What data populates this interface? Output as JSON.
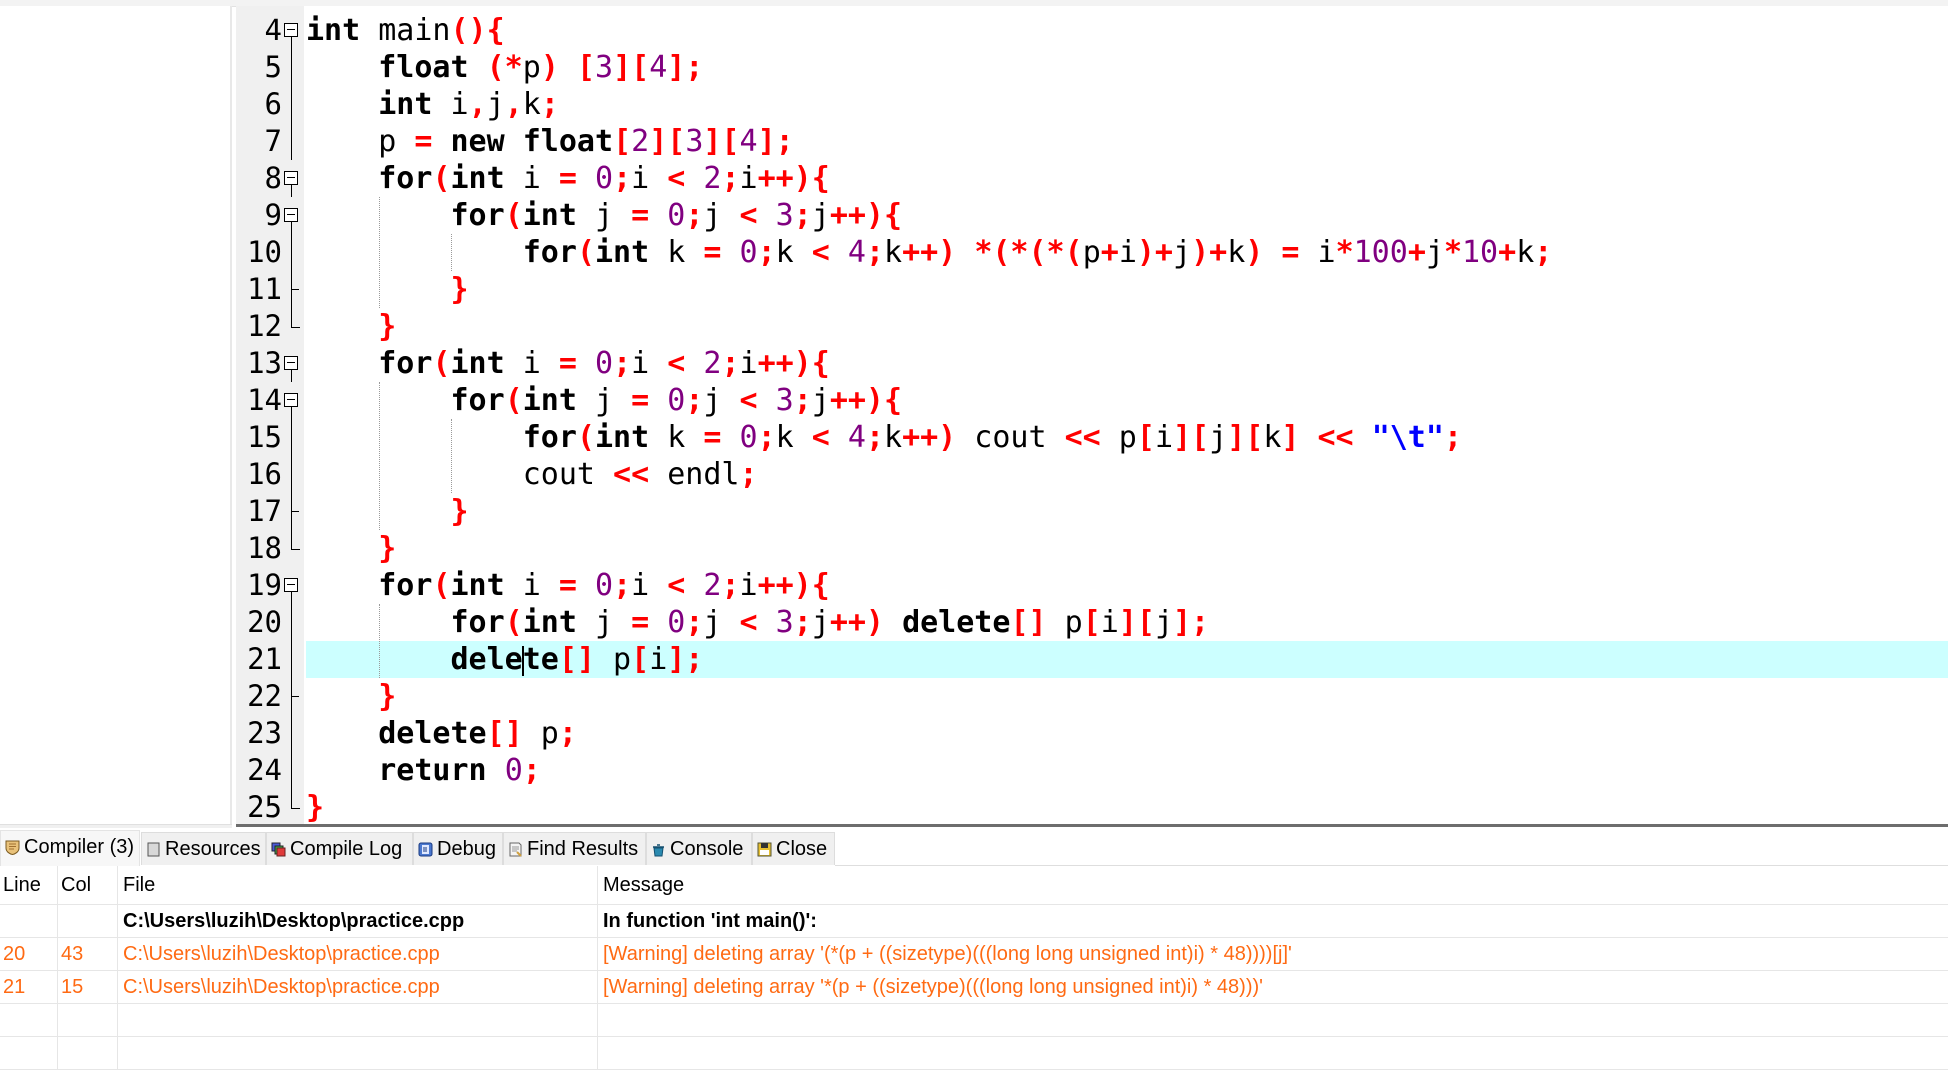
{
  "editor": {
    "current_line": 21,
    "lines": [
      {
        "n": "4",
        "fold": "start",
        "tokens": [
          [
            "kw",
            "int"
          ],
          [
            "id",
            " main"
          ],
          [
            "op",
            "(){"
          ]
        ]
      },
      {
        "n": "5",
        "fold": "mid",
        "tokens": [
          [
            "id",
            "    "
          ],
          [
            "kw",
            "float"
          ],
          [
            "id",
            " "
          ],
          [
            "op",
            "(*"
          ],
          [
            "id",
            "p"
          ],
          [
            "op",
            ")"
          ],
          [
            "id",
            " "
          ],
          [
            "op",
            "["
          ],
          [
            "num",
            "3"
          ],
          [
            "op",
            "]["
          ],
          [
            "num",
            "4"
          ],
          [
            "op",
            "];"
          ]
        ]
      },
      {
        "n": "6",
        "fold": "mid",
        "tokens": [
          [
            "id",
            "    "
          ],
          [
            "kw",
            "int"
          ],
          [
            "id",
            " i"
          ],
          [
            "op",
            ","
          ],
          [
            "id",
            "j"
          ],
          [
            "op",
            ","
          ],
          [
            "id",
            "k"
          ],
          [
            "op",
            ";"
          ]
        ]
      },
      {
        "n": "7",
        "fold": "mid",
        "tokens": [
          [
            "id",
            "    p "
          ],
          [
            "op",
            "="
          ],
          [
            "id",
            " "
          ],
          [
            "kw",
            "new float"
          ],
          [
            "op",
            "["
          ],
          [
            "num",
            "2"
          ],
          [
            "op",
            "]["
          ],
          [
            "num",
            "3"
          ],
          [
            "op",
            "]["
          ],
          [
            "num",
            "4"
          ],
          [
            "op",
            "];"
          ]
        ]
      },
      {
        "n": "8",
        "fold": "start",
        "tokens": [
          [
            "id",
            "    "
          ],
          [
            "kw",
            "for"
          ],
          [
            "op",
            "("
          ],
          [
            "kw",
            "int"
          ],
          [
            "id",
            " i "
          ],
          [
            "op",
            "="
          ],
          [
            "id",
            " "
          ],
          [
            "num",
            "0"
          ],
          [
            "op",
            ";"
          ],
          [
            "id",
            "i "
          ],
          [
            "op",
            "<"
          ],
          [
            "id",
            " "
          ],
          [
            "num",
            "2"
          ],
          [
            "op",
            ";"
          ],
          [
            "id",
            "i"
          ],
          [
            "op",
            "++){"
          ]
        ]
      },
      {
        "n": "9",
        "fold": "start",
        "tokens": [
          [
            "id",
            "        "
          ],
          [
            "kw",
            "for"
          ],
          [
            "op",
            "("
          ],
          [
            "kw",
            "int"
          ],
          [
            "id",
            " j "
          ],
          [
            "op",
            "="
          ],
          [
            "id",
            " "
          ],
          [
            "num",
            "0"
          ],
          [
            "op",
            ";"
          ],
          [
            "id",
            "j "
          ],
          [
            "op",
            "<"
          ],
          [
            "id",
            " "
          ],
          [
            "num",
            "3"
          ],
          [
            "op",
            ";"
          ],
          [
            "id",
            "j"
          ],
          [
            "op",
            "++){"
          ]
        ]
      },
      {
        "n": "10",
        "fold": "mid",
        "tokens": [
          [
            "id",
            "            "
          ],
          [
            "kw",
            "for"
          ],
          [
            "op",
            "("
          ],
          [
            "kw",
            "int"
          ],
          [
            "id",
            " k "
          ],
          [
            "op",
            "="
          ],
          [
            "id",
            " "
          ],
          [
            "num",
            "0"
          ],
          [
            "op",
            ";"
          ],
          [
            "id",
            "k "
          ],
          [
            "op",
            "<"
          ],
          [
            "id",
            " "
          ],
          [
            "num",
            "4"
          ],
          [
            "op",
            ";"
          ],
          [
            "id",
            "k"
          ],
          [
            "op",
            "++)"
          ],
          [
            "id",
            " "
          ],
          [
            "op",
            "*(*(*("
          ],
          [
            "id",
            "p"
          ],
          [
            "op",
            "+"
          ],
          [
            "id",
            "i"
          ],
          [
            "op",
            ")+"
          ],
          [
            "id",
            "j"
          ],
          [
            "op",
            ")+"
          ],
          [
            "id",
            "k"
          ],
          [
            "op",
            ")"
          ],
          [
            "id",
            " "
          ],
          [
            "op",
            "="
          ],
          [
            "id",
            " i"
          ],
          [
            "op",
            "*"
          ],
          [
            "num",
            "100"
          ],
          [
            "op",
            "+"
          ],
          [
            "id",
            "j"
          ],
          [
            "op",
            "*"
          ],
          [
            "num",
            "10"
          ],
          [
            "op",
            "+"
          ],
          [
            "id",
            "k"
          ],
          [
            "op",
            ";"
          ]
        ]
      },
      {
        "n": "11",
        "fold": "end-mid",
        "tokens": [
          [
            "id",
            "        "
          ],
          [
            "op",
            "}"
          ]
        ]
      },
      {
        "n": "12",
        "fold": "end",
        "tokens": [
          [
            "id",
            "    "
          ],
          [
            "op",
            "}"
          ]
        ]
      },
      {
        "n": "13",
        "fold": "start",
        "tokens": [
          [
            "id",
            "    "
          ],
          [
            "kw",
            "for"
          ],
          [
            "op",
            "("
          ],
          [
            "kw",
            "int"
          ],
          [
            "id",
            " i "
          ],
          [
            "op",
            "="
          ],
          [
            "id",
            " "
          ],
          [
            "num",
            "0"
          ],
          [
            "op",
            ";"
          ],
          [
            "id",
            "i "
          ],
          [
            "op",
            "<"
          ],
          [
            "id",
            " "
          ],
          [
            "num",
            "2"
          ],
          [
            "op",
            ";"
          ],
          [
            "id",
            "i"
          ],
          [
            "op",
            "++){"
          ]
        ]
      },
      {
        "n": "14",
        "fold": "start",
        "tokens": [
          [
            "id",
            "        "
          ],
          [
            "kw",
            "for"
          ],
          [
            "op",
            "("
          ],
          [
            "kw",
            "int"
          ],
          [
            "id",
            " j "
          ],
          [
            "op",
            "="
          ],
          [
            "id",
            " "
          ],
          [
            "num",
            "0"
          ],
          [
            "op",
            ";"
          ],
          [
            "id",
            "j "
          ],
          [
            "op",
            "<"
          ],
          [
            "id",
            " "
          ],
          [
            "num",
            "3"
          ],
          [
            "op",
            ";"
          ],
          [
            "id",
            "j"
          ],
          [
            "op",
            "++){"
          ]
        ]
      },
      {
        "n": "15",
        "fold": "mid",
        "tokens": [
          [
            "id",
            "            "
          ],
          [
            "kw",
            "for"
          ],
          [
            "op",
            "("
          ],
          [
            "kw",
            "int"
          ],
          [
            "id",
            " k "
          ],
          [
            "op",
            "="
          ],
          [
            "id",
            " "
          ],
          [
            "num",
            "0"
          ],
          [
            "op",
            ";"
          ],
          [
            "id",
            "k "
          ],
          [
            "op",
            "<"
          ],
          [
            "id",
            " "
          ],
          [
            "num",
            "4"
          ],
          [
            "op",
            ";"
          ],
          [
            "id",
            "k"
          ],
          [
            "op",
            "++)"
          ],
          [
            "id",
            " cout "
          ],
          [
            "op",
            "<<"
          ],
          [
            "id",
            " p"
          ],
          [
            "op",
            "["
          ],
          [
            "id",
            "i"
          ],
          [
            "op",
            "]["
          ],
          [
            "id",
            "j"
          ],
          [
            "op",
            "]["
          ],
          [
            "id",
            "k"
          ],
          [
            "op",
            "]"
          ],
          [
            "id",
            " "
          ],
          [
            "op",
            "<<"
          ],
          [
            "id",
            " "
          ],
          [
            "str",
            "\"\\t\""
          ],
          [
            "op",
            ";"
          ]
        ]
      },
      {
        "n": "16",
        "fold": "mid",
        "tokens": [
          [
            "id",
            "            cout "
          ],
          [
            "op",
            "<<"
          ],
          [
            "id",
            " endl"
          ],
          [
            "op",
            ";"
          ]
        ]
      },
      {
        "n": "17",
        "fold": "end-mid",
        "tokens": [
          [
            "id",
            "        "
          ],
          [
            "op",
            "}"
          ]
        ]
      },
      {
        "n": "18",
        "fold": "end",
        "tokens": [
          [
            "id",
            "    "
          ],
          [
            "op",
            "}"
          ]
        ]
      },
      {
        "n": "19",
        "fold": "start",
        "tokens": [
          [
            "id",
            "    "
          ],
          [
            "kw",
            "for"
          ],
          [
            "op",
            "("
          ],
          [
            "kw",
            "int"
          ],
          [
            "id",
            " i "
          ],
          [
            "op",
            "="
          ],
          [
            "id",
            " "
          ],
          [
            "num",
            "0"
          ],
          [
            "op",
            ";"
          ],
          [
            "id",
            "i "
          ],
          [
            "op",
            "<"
          ],
          [
            "id",
            " "
          ],
          [
            "num",
            "2"
          ],
          [
            "op",
            ";"
          ],
          [
            "id",
            "i"
          ],
          [
            "op",
            "++){"
          ]
        ]
      },
      {
        "n": "20",
        "fold": "mid",
        "tokens": [
          [
            "id",
            "        "
          ],
          [
            "kw",
            "for"
          ],
          [
            "op",
            "("
          ],
          [
            "kw",
            "int"
          ],
          [
            "id",
            " j "
          ],
          [
            "op",
            "="
          ],
          [
            "id",
            " "
          ],
          [
            "num",
            "0"
          ],
          [
            "op",
            ";"
          ],
          [
            "id",
            "j "
          ],
          [
            "op",
            "<"
          ],
          [
            "id",
            " "
          ],
          [
            "num",
            "3"
          ],
          [
            "op",
            ";"
          ],
          [
            "id",
            "j"
          ],
          [
            "op",
            "++)"
          ],
          [
            "id",
            " "
          ],
          [
            "kw",
            "delete"
          ],
          [
            "op",
            "[]"
          ],
          [
            "id",
            " p"
          ],
          [
            "op",
            "["
          ],
          [
            "id",
            "i"
          ],
          [
            "op",
            "]["
          ],
          [
            "id",
            "j"
          ],
          [
            "op",
            "];"
          ]
        ]
      },
      {
        "n": "21",
        "fold": "mid",
        "tokens": [
          [
            "id",
            "        "
          ],
          [
            "kw",
            "dele"
          ],
          [
            "caret",
            ""
          ],
          [
            "kw",
            "te"
          ],
          [
            "op",
            "[]"
          ],
          [
            "id",
            " p"
          ],
          [
            "op",
            "["
          ],
          [
            "id",
            "i"
          ],
          [
            "op",
            "];"
          ]
        ]
      },
      {
        "n": "22",
        "fold": "end-mid",
        "tokens": [
          [
            "id",
            "    "
          ],
          [
            "op",
            "}"
          ]
        ]
      },
      {
        "n": "23",
        "fold": "mid",
        "tokens": [
          [
            "id",
            "    "
          ],
          [
            "kw",
            "delete"
          ],
          [
            "op",
            "[]"
          ],
          [
            "id",
            " p"
          ],
          [
            "op",
            ";"
          ]
        ]
      },
      {
        "n": "24",
        "fold": "mid",
        "tokens": [
          [
            "id",
            "    "
          ],
          [
            "kw",
            "return"
          ],
          [
            "id",
            " "
          ],
          [
            "num",
            "0"
          ],
          [
            "op",
            ";"
          ]
        ]
      },
      {
        "n": "25",
        "fold": "end",
        "tokens": [
          [
            "op",
            "}"
          ]
        ]
      }
    ]
  },
  "bottom_panel": {
    "tabs": [
      {
        "label": "Compiler (3)",
        "icon": "compiler-icon",
        "active": true
      },
      {
        "label": "Resources",
        "icon": "resources-icon",
        "active": false
      },
      {
        "label": "Compile Log",
        "icon": "compile-log-icon",
        "active": false
      },
      {
        "label": "Debug",
        "icon": "debug-icon",
        "active": false
      },
      {
        "label": "Find Results",
        "icon": "find-results-icon",
        "active": false
      },
      {
        "label": "Console",
        "icon": "console-icon",
        "active": false
      },
      {
        "label": "Close",
        "icon": "close-icon",
        "active": false
      }
    ],
    "table": {
      "headers": {
        "line": "Line",
        "col": "Col",
        "file": "File",
        "message": "Message"
      },
      "rows": [
        {
          "line": "",
          "col": "",
          "file": "C:\\Users\\luzih\\Desktop\\practice.cpp",
          "message": "In function 'int main()':",
          "style": "bold"
        },
        {
          "line": "20",
          "col": "43",
          "file": "C:\\Users\\luzih\\Desktop\\practice.cpp",
          "message": "[Warning] deleting array '(*(p + ((sizetype)(((long long unsigned int)i) * 48))))[j]'",
          "style": "warn"
        },
        {
          "line": "21",
          "col": "15",
          "file": "C:\\Users\\luzih\\Desktop\\practice.cpp",
          "message": "[Warning] deleting array '*(p + ((sizetype)(((long long unsigned int)i) * 48)))'",
          "style": "warn"
        },
        {
          "line": "",
          "col": "",
          "file": "",
          "message": "",
          "style": ""
        },
        {
          "line": "",
          "col": "",
          "file": "",
          "message": "",
          "style": ""
        }
      ]
    }
  },
  "colors": {
    "warning": "#ff6a13",
    "keyword": "#000000",
    "operator": "#ff0000",
    "number": "#800080",
    "string": "#0000ff",
    "current_line": "#ccffff"
  }
}
